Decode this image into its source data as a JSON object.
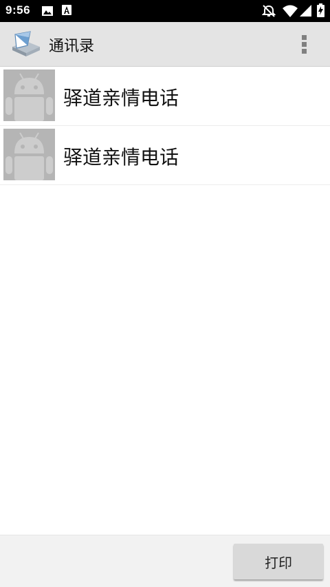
{
  "status_bar": {
    "time": "9:56",
    "icons": [
      "image-notification-icon",
      "a-notification-icon",
      "alarm-off-icon",
      "wifi-icon",
      "signal-icon",
      "battery-charging-icon"
    ]
  },
  "app_bar": {
    "title": "通讯录",
    "app_icon": "printer-app-icon",
    "menu_icon": "more-vert-icon",
    "background": "#e4e4e4"
  },
  "contacts": [
    {
      "name": "驿道亲情电话",
      "avatar": "android-avatar-icon"
    },
    {
      "name": "驿道亲情电话",
      "avatar": "android-avatar-icon"
    }
  ],
  "bottom_bar": {
    "print_label": "打印"
  }
}
